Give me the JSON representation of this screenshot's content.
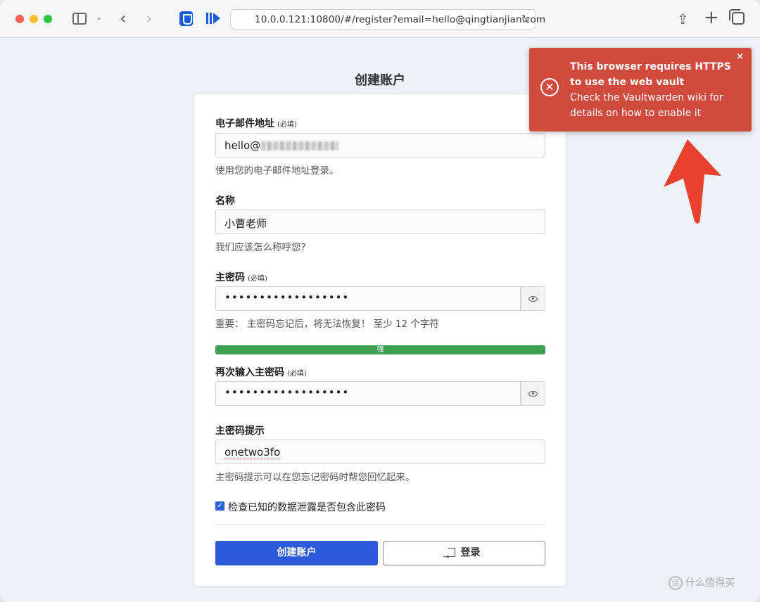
{
  "browser": {
    "url": "10.0.0.121:10800/#/register?email=hello@qingtianjian.com"
  },
  "page": {
    "title": "创建账户"
  },
  "form": {
    "email": {
      "label": "电子邮件地址",
      "required": "(必填)",
      "value": "hello@",
      "help": "使用您的电子邮件地址登录。"
    },
    "name": {
      "label": "名称",
      "value": "小曹老师",
      "help": "我们应该怎么称呼您?"
    },
    "master_password": {
      "label": "主密码",
      "required": "(必填)",
      "value": "••••••••••••••••••",
      "help": "重要： 主密码忘记后，将无法恢复！ 至少 12 个字符",
      "strength": "强",
      "strength_fraction": 1.0
    },
    "confirm_password": {
      "label": "再次输入主密码",
      "required": "(必填)",
      "value": "••••••••••••••••••"
    },
    "hint": {
      "label": "主密码提示",
      "value": "onetwo3fo",
      "help": "主密码提示可以在您忘记密码时帮您回忆起来。"
    },
    "breach_check": {
      "label": "检查已知的数据泄露是否包含此密码",
      "checked": true
    },
    "create_button": "创建账户",
    "login_button": "登录"
  },
  "toast": {
    "title": "This browser requires HTTPS to use the web vault",
    "message": "Check the Vaultwarden wiki for details on how to enable it",
    "close": "×",
    "color": "#d04a3e"
  },
  "watermark": {
    "logo": "值",
    "text": "什么值得买"
  },
  "colors": {
    "primary": "#2b5bd8",
    "strength": "#3e9f53",
    "annotation_arrow": "#e8412f"
  }
}
